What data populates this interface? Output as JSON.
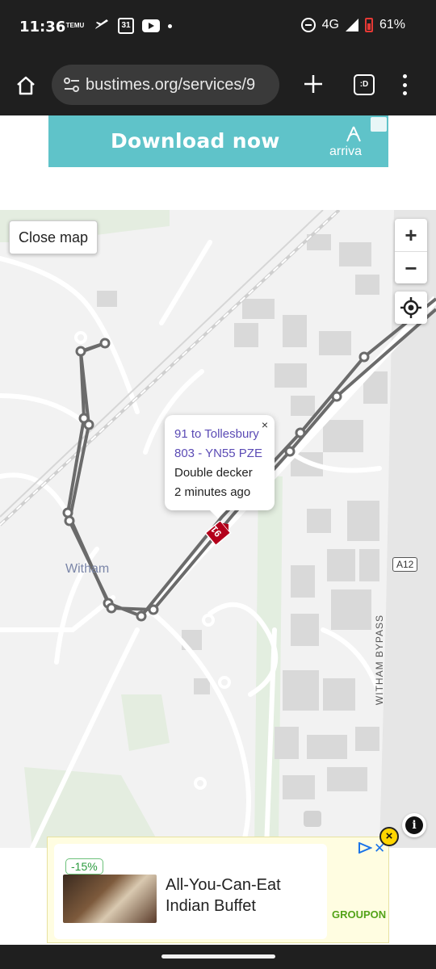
{
  "status_bar": {
    "time": "11:36",
    "temu_label": "TEMU",
    "calendar_day": "31",
    "network": "4G",
    "battery": "61%"
  },
  "browser": {
    "url": "bustimes.org/services/9",
    "tab_switcher_label": ":D"
  },
  "ad_top": {
    "cta": "Download now",
    "brand": "arriva",
    "color": "#5fc3c9"
  },
  "map": {
    "close_button": "Close map",
    "zoom_in": "+",
    "zoom_out": "−",
    "popup": {
      "service": "91 to Tollesbury",
      "vehicle": "803 - YN55 PZE",
      "type": "Double decker",
      "updated": "2 minutes ago",
      "close": "×"
    },
    "bus_marker_label": "91",
    "place_label": "Witham",
    "road_badge": "A12",
    "road_name": "WITHAM BYPASS",
    "info_glyph": "i",
    "route_color": "#6b6b6b",
    "bus_color": "#b3001b"
  },
  "ad_bottom": {
    "discount": "-15%",
    "title": "All-You-Can-Eat Indian Buffet",
    "brand": "GROUPON",
    "close": "×"
  }
}
